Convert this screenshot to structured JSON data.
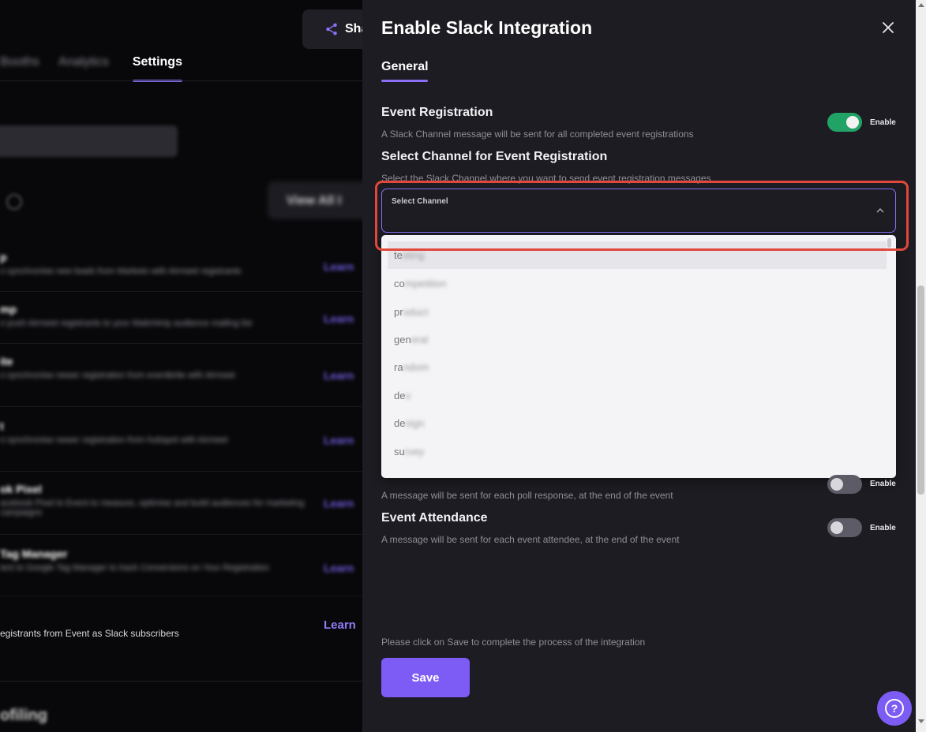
{
  "background": {
    "share_label": "Sha",
    "tabs": [
      {
        "label": "Booths"
      },
      {
        "label": "Analytics"
      },
      {
        "label": "Settings"
      }
    ],
    "view_all": "View All I",
    "integrations": [
      {
        "title": "p",
        "desc": "o synchronise new leads from Marketo with Airmeet registrants",
        "learn": "Learn"
      },
      {
        "title": "mp",
        "desc": "o push Airmeet registrants to your Mailchimp audience mailing list",
        "learn": "Learn"
      },
      {
        "title": "ite",
        "desc": "o synchronise newer registration from eventbrite with Airmeet",
        "learn": "Learn"
      },
      {
        "title": "t",
        "desc": "o synchronise newer registration from hubspot with Airmeet",
        "learn": "Learn"
      },
      {
        "title": "ok Pixel",
        "desc": "acebook Pixel to Event to measure, optimise and build audiences for marketing campaigns",
        "learn": "Learn"
      },
      {
        "title": "Tag Manager",
        "desc": "ient to Google Tag Manager to track Conversions on Your Registration",
        "learn": "Learn"
      }
    ],
    "slack_desc": "egistrants from Event as Slack subscribers",
    "slack_learn": "Learn",
    "profiling": "ofiling"
  },
  "drawer": {
    "title": "Enable Slack Integration",
    "tab": "General",
    "event_registration": {
      "title": "Event Registration",
      "desc": "A Slack Channel message will be sent for all completed event registrations",
      "toggle_label": "Enable"
    },
    "select_channel": {
      "title": "Select Channel for Event Registration",
      "desc": "Select the Slack Channel where you want to send event registration messages",
      "field_label": "Select Channel"
    },
    "channel_options": [
      {
        "prefix": "te",
        "rest": "sting"
      },
      {
        "prefix": "co",
        "rest": "mpetition"
      },
      {
        "prefix": "pr",
        "rest": "oduct"
      },
      {
        "prefix": "gen",
        "rest": "eral"
      },
      {
        "prefix": "ra",
        "rest": "ndom"
      },
      {
        "prefix": "de",
        "rest": "v"
      },
      {
        "prefix": "de",
        "rest": "sign"
      },
      {
        "prefix": "su",
        "rest": "rvey"
      }
    ],
    "poll_response": {
      "desc": "A message will be sent for each poll response, at the end of the event",
      "toggle_label": "Enable"
    },
    "event_attendance": {
      "title": "Event Attendance",
      "desc": "A message will be sent for each event attendee, at the end of the event",
      "toggle_label": "Enable"
    },
    "footer_note": "Please click on Save to complete the process of the integration",
    "save_label": "Save"
  },
  "help_icon_glyph": "?",
  "colors": {
    "accent": "#8b6ff5",
    "primary_button": "#7c5cf5",
    "toggle_on": "#21a366",
    "highlight": "#e1473b"
  }
}
